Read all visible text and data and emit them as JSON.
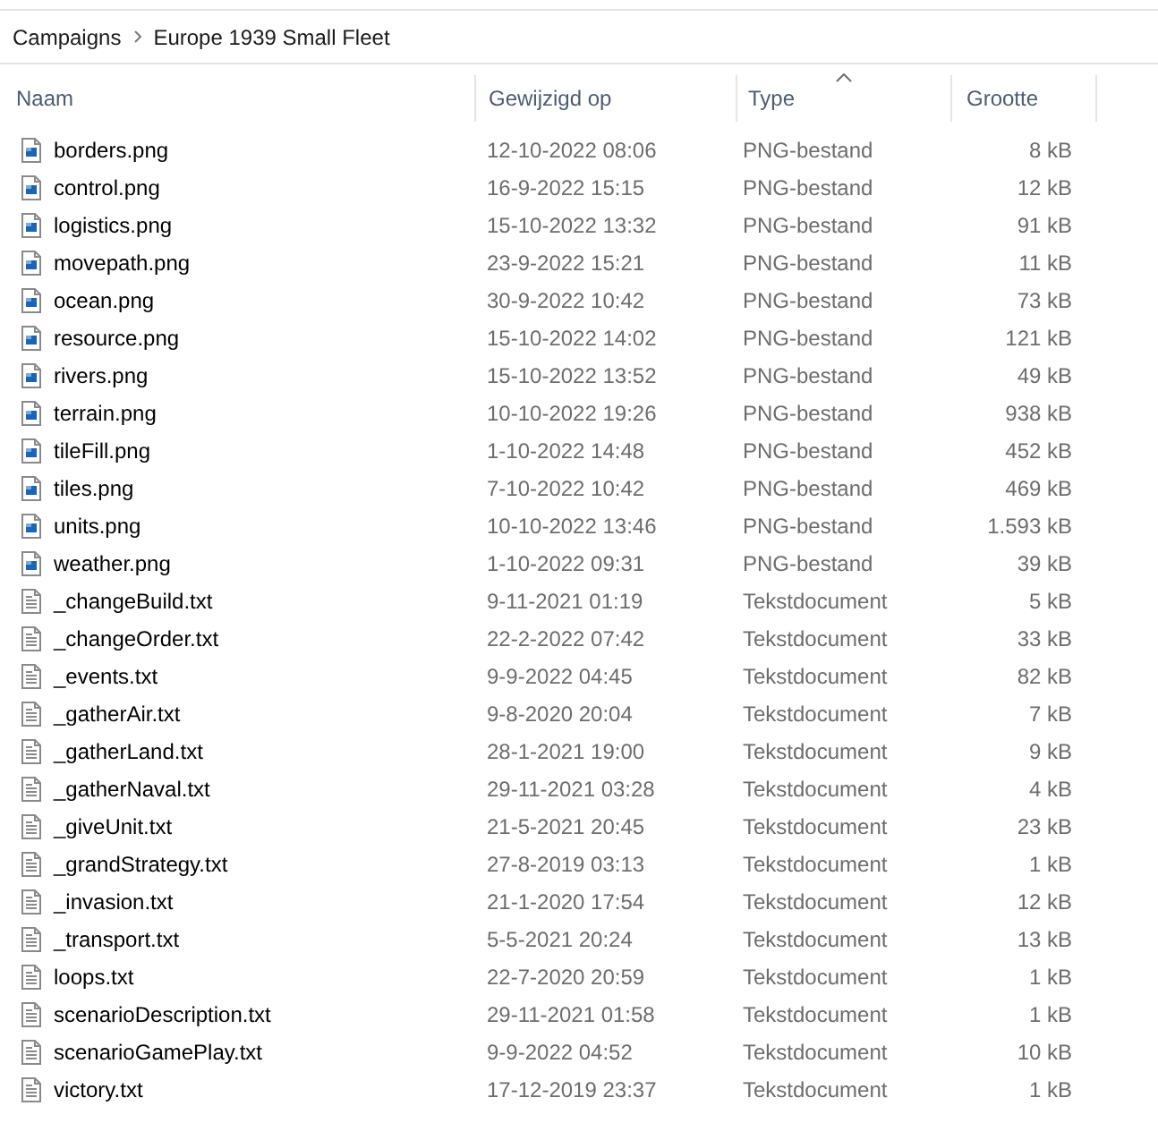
{
  "breadcrumb": [
    {
      "label": "Campaigns"
    },
    {
      "label": "Europe 1939 Small Fleet"
    }
  ],
  "columns": [
    {
      "label": "Naam",
      "sorted": false
    },
    {
      "label": "Gewijzigd op",
      "sorted": false
    },
    {
      "label": "Type",
      "sorted": true
    },
    {
      "label": "Grootte",
      "sorted": false
    }
  ],
  "files": [
    {
      "kind": "image",
      "name": "borders.png",
      "modified": "12-10-2022 08:06",
      "type": "PNG-bestand",
      "size": "8 kB"
    },
    {
      "kind": "image",
      "name": "control.png",
      "modified": "16-9-2022 15:15",
      "type": "PNG-bestand",
      "size": "12 kB"
    },
    {
      "kind": "image",
      "name": "logistics.png",
      "modified": "15-10-2022 13:32",
      "type": "PNG-bestand",
      "size": "91 kB"
    },
    {
      "kind": "image",
      "name": "movepath.png",
      "modified": "23-9-2022 15:21",
      "type": "PNG-bestand",
      "size": "11 kB"
    },
    {
      "kind": "image",
      "name": "ocean.png",
      "modified": "30-9-2022 10:42",
      "type": "PNG-bestand",
      "size": "73 kB"
    },
    {
      "kind": "image",
      "name": "resource.png",
      "modified": "15-10-2022 14:02",
      "type": "PNG-bestand",
      "size": "121 kB"
    },
    {
      "kind": "image",
      "name": "rivers.png",
      "modified": "15-10-2022 13:52",
      "type": "PNG-bestand",
      "size": "49 kB"
    },
    {
      "kind": "image",
      "name": "terrain.png",
      "modified": "10-10-2022 19:26",
      "type": "PNG-bestand",
      "size": "938 kB"
    },
    {
      "kind": "image",
      "name": "tileFill.png",
      "modified": "1-10-2022 14:48",
      "type": "PNG-bestand",
      "size": "452 kB"
    },
    {
      "kind": "image",
      "name": "tiles.png",
      "modified": "7-10-2022 10:42",
      "type": "PNG-bestand",
      "size": "469 kB"
    },
    {
      "kind": "image",
      "name": "units.png",
      "modified": "10-10-2022 13:46",
      "type": "PNG-bestand",
      "size": "1.593 kB"
    },
    {
      "kind": "image",
      "name": "weather.png",
      "modified": "1-10-2022 09:31",
      "type": "PNG-bestand",
      "size": "39 kB"
    },
    {
      "kind": "text",
      "name": "_changeBuild.txt",
      "modified": "9-11-2021 01:19",
      "type": "Tekstdocument",
      "size": "5 kB"
    },
    {
      "kind": "text",
      "name": "_changeOrder.txt",
      "modified": "22-2-2022 07:42",
      "type": "Tekstdocument",
      "size": "33 kB"
    },
    {
      "kind": "text",
      "name": "_events.txt",
      "modified": "9-9-2022 04:45",
      "type": "Tekstdocument",
      "size": "82 kB"
    },
    {
      "kind": "text",
      "name": "_gatherAir.txt",
      "modified": "9-8-2020 20:04",
      "type": "Tekstdocument",
      "size": "7 kB"
    },
    {
      "kind": "text",
      "name": "_gatherLand.txt",
      "modified": "28-1-2021 19:00",
      "type": "Tekstdocument",
      "size": "9 kB"
    },
    {
      "kind": "text",
      "name": "_gatherNaval.txt",
      "modified": "29-11-2021 03:28",
      "type": "Tekstdocument",
      "size": "4 kB"
    },
    {
      "kind": "text",
      "name": "_giveUnit.txt",
      "modified": "21-5-2021 20:45",
      "type": "Tekstdocument",
      "size": "23 kB"
    },
    {
      "kind": "text",
      "name": "_grandStrategy.txt",
      "modified": "27-8-2019 03:13",
      "type": "Tekstdocument",
      "size": "1 kB"
    },
    {
      "kind": "text",
      "name": "_invasion.txt",
      "modified": "21-1-2020 17:54",
      "type": "Tekstdocument",
      "size": "12 kB"
    },
    {
      "kind": "text",
      "name": "_transport.txt",
      "modified": "5-5-2021 20:24",
      "type": "Tekstdocument",
      "size": "13 kB"
    },
    {
      "kind": "text",
      "name": "loops.txt",
      "modified": "22-7-2020 20:59",
      "type": "Tekstdocument",
      "size": "1 kB"
    },
    {
      "kind": "text",
      "name": "scenarioDescription.txt",
      "modified": "29-11-2021 01:58",
      "type": "Tekstdocument",
      "size": "1 kB"
    },
    {
      "kind": "text",
      "name": "scenarioGamePlay.txt",
      "modified": "9-9-2022 04:52",
      "type": "Tekstdocument",
      "size": "10 kB"
    },
    {
      "kind": "text",
      "name": "victory.txt",
      "modified": "17-12-2019 23:37",
      "type": "Tekstdocument",
      "size": "1 kB"
    }
  ]
}
